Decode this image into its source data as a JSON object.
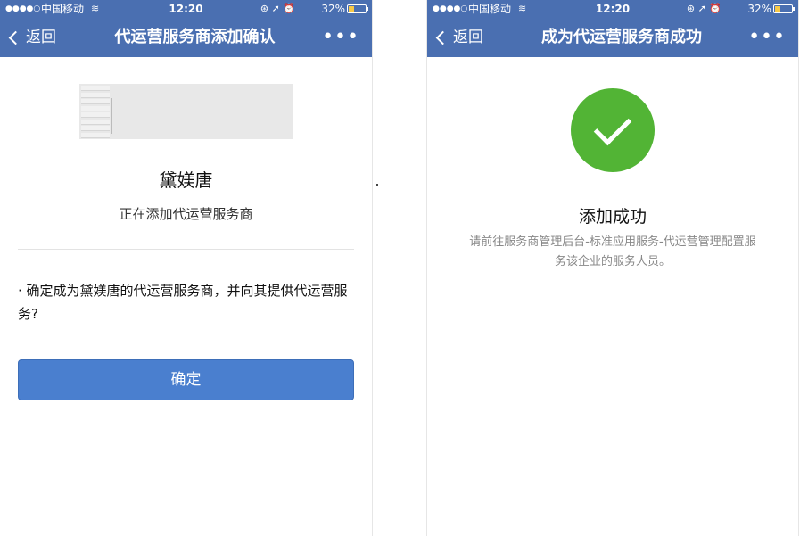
{
  "status_bar": {
    "signal": "●●●●○",
    "carrier": "中国移动",
    "wifi": "≋",
    "time": "12:20",
    "icons": "⊛ ➚ ⏰",
    "battery": "32%"
  },
  "left": {
    "nav": {
      "back_label": "返回",
      "title": "代运营服务商添加确认",
      "more": "•••"
    },
    "company_name": "黛媄唐",
    "subtitle": "正在添加代运营服务商",
    "question": "· 确定成为黛媄唐的代运营服务商，并向其提供代运营服务?",
    "confirm_button": "确定"
  },
  "right": {
    "nav": {
      "back_label": "返回",
      "title": "成为代运营服务商成功",
      "more": "•••"
    },
    "success_title": "添加成功",
    "success_description": "请前往服务商管理后台-标准应用服务-代运营管理配置服务该企业的服务人员。"
  },
  "colors": {
    "header": "#4a6fb1",
    "button": "#4a7fcf",
    "success": "#52b435"
  }
}
